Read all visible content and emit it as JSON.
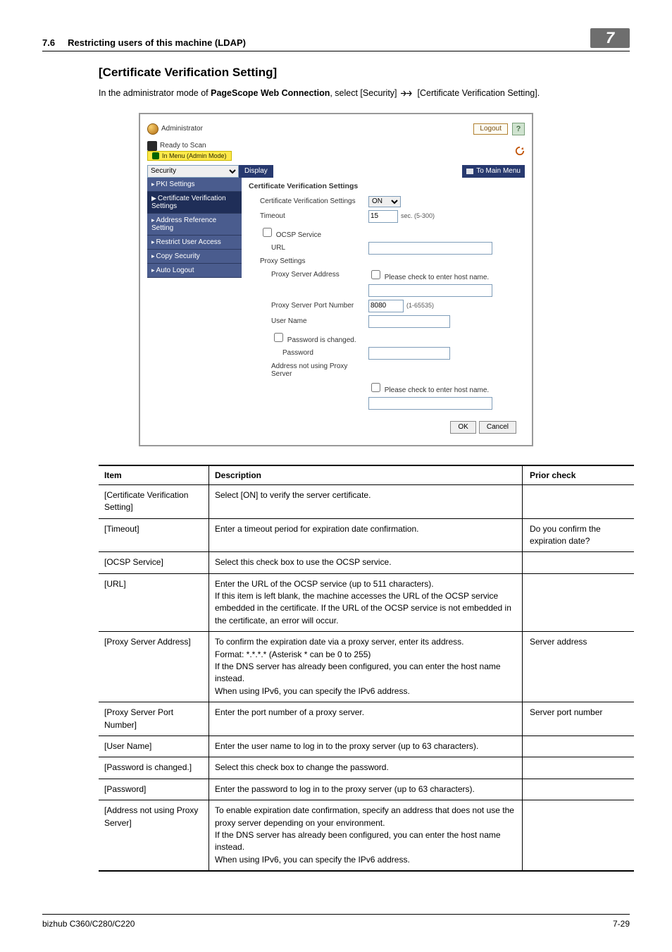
{
  "header": {
    "section_no": "7.6",
    "section_title": "Restricting users of this machine (LDAP)",
    "tab_number": "7"
  },
  "title": "[Certificate Verification Setting]",
  "intro_pre": "In the administrator mode of ",
  "intro_bold": "PageScope Web Connection",
  "intro_post1": ", select [Security] ",
  "intro_post2": " [Certificate Verification Setting].",
  "shot": {
    "admin_label": "Administrator",
    "logout": "Logout",
    "help": "?",
    "ready": "Ready to Scan",
    "mode": "In Menu (Admin Mode)",
    "security_select": "Security",
    "display": "Display",
    "to_main": "To Main Menu",
    "nav": [
      "PKI Settings",
      "Certificate Verification Settings",
      "Address Reference Setting",
      "Restrict User Access",
      "Copy Security",
      "Auto Logout"
    ],
    "content": {
      "heading": "Certificate Verification Settings",
      "cvs_label": "Certificate Verification Settings",
      "cvs_value": "ON",
      "timeout_label": "Timeout",
      "timeout_value": "15",
      "timeout_hint": "sec. (5-300)",
      "ocsp_label": "OCSP Service",
      "url_label": "URL",
      "proxy_heading": "Proxy Settings",
      "proxy_addr_label": "Proxy Server Address",
      "host_check_label": "Please check to enter host name.",
      "proxy_port_label": "Proxy Server Port Number",
      "proxy_port_value": "8080",
      "proxy_port_hint": "(1-65535)",
      "user_name_label": "User Name",
      "pwd_changed_label": "Password is changed.",
      "pwd_label": "Password",
      "addr_not_label": "Address not using Proxy Server",
      "ok": "OK",
      "cancel": "Cancel"
    }
  },
  "table": {
    "head": [
      "Item",
      "Description",
      "Prior check"
    ],
    "rows": [
      {
        "item": "[Certificate Verification Setting]",
        "desc": "Select [ON] to verify the server certificate.",
        "prior": ""
      },
      {
        "item": "[Timeout]",
        "desc": "Enter a timeout period for expiration date confirmation.",
        "prior": "Do you confirm the expiration date?"
      },
      {
        "item": "[OCSP Service]",
        "desc": "Select this check box to use the OCSP service.",
        "prior": ""
      },
      {
        "item": "[URL]",
        "desc": "Enter the URL of the OCSP service (up to 511 characters).\nIf this item is left blank, the machine accesses the URL of the OCSP service embedded in the certificate. If the URL of the OCSP service is not embedded in the certificate, an error will occur.",
        "prior": ""
      },
      {
        "item": "[Proxy Server Address]",
        "desc": "To confirm the expiration date via a proxy server, enter its address.\nFormat: *.*.*.* (Asterisk * can be 0 to 255)\nIf the DNS server has already been configured, you can enter the host name instead.\nWhen using IPv6, you can specify the IPv6 address.",
        "prior": "Server address"
      },
      {
        "item": "[Proxy Server Port Number]",
        "desc": "Enter the port number of a proxy server.",
        "prior": "Server port number"
      },
      {
        "item": "[User Name]",
        "desc": "Enter the user name to log in to the proxy server (up to 63 characters).",
        "prior": ""
      },
      {
        "item": "[Password is changed.]",
        "desc": "Select this check box to change the password.",
        "prior": ""
      },
      {
        "item": "[Password]",
        "desc": "Enter the password to log in to the proxy server (up to 63 characters).",
        "prior": ""
      },
      {
        "item": "[Address not using Proxy Server]",
        "desc": "To enable expiration date confirmation, specify an address that does not use the proxy server depending on your environment.\nIf the DNS server has already been configured, you can enter the host name instead.\nWhen using IPv6, you can specify the IPv6 address.",
        "prior": ""
      }
    ]
  },
  "footer": {
    "left": "bizhub C360/C280/C220",
    "right": "7-29"
  }
}
